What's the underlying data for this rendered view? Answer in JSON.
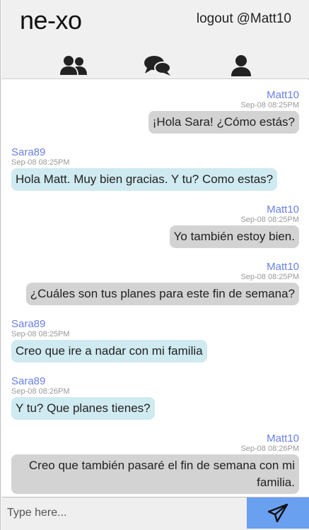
{
  "app": {
    "logo": "ne-xo"
  },
  "header": {
    "logout_label": "logout",
    "username": "@Matt10"
  },
  "nav": {
    "items": [
      {
        "name": "users",
        "icon": "users-icon"
      },
      {
        "name": "chats",
        "icon": "chat-bubbles-icon"
      },
      {
        "name": "profile",
        "icon": "user-icon"
      }
    ]
  },
  "messages": [
    {
      "author": "Matt10",
      "time": "Sep-08 08:25PM",
      "text": "¡Hola Sara! ¿Cómo estás?",
      "mine": true
    },
    {
      "author": "Sara89",
      "time": "Sep-08 08:25PM",
      "text": "Hola Matt. Muy bien gracias. Y tu? Como estas?",
      "mine": false
    },
    {
      "author": "Matt10",
      "time": "Sep-08 08:25PM",
      "text": "Yo también estoy bien.",
      "mine": true
    },
    {
      "author": "Matt10",
      "time": "Sep-08 08:25PM",
      "text": "¿Cuáles son tus planes para este fin de semana?",
      "mine": true
    },
    {
      "author": "Sara89",
      "time": "Sep-08 08:25PM",
      "text": "Creo que ire a nadar con mi familia",
      "mine": false
    },
    {
      "author": "Sara89",
      "time": "Sep-08 08:26PM",
      "text": "Y tu? Que planes tienes?",
      "mine": false
    },
    {
      "author": "Matt10",
      "time": "Sep-08 08:26PM",
      "text": "Creo que también pasaré el fin de semana con mi familia.",
      "mine": true
    }
  ],
  "composer": {
    "placeholder": "Type here...",
    "value": "",
    "send_icon": "paper-plane-icon"
  },
  "colors": {
    "accent": "#6a80e6",
    "own_bubble": "#d3d3d3",
    "other_bubble": "#cfeaf0",
    "send_button": "#6aa0f0",
    "header_bg": "#f0f0f0"
  }
}
